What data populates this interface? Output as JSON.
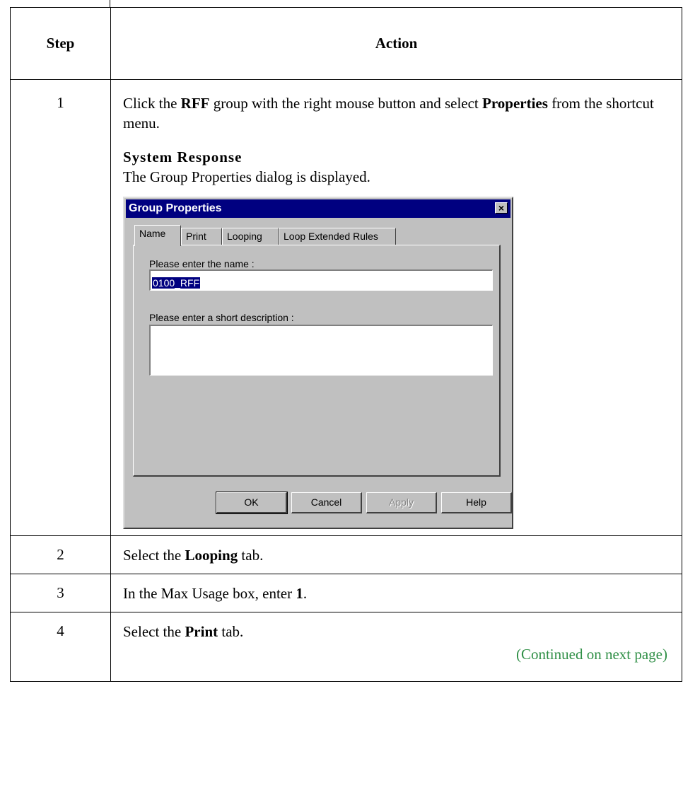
{
  "headers": {
    "step": "Step",
    "action": "Action"
  },
  "steps": [
    {
      "num": "1",
      "text_pre": "Click the ",
      "bold1": "RFF",
      "text_mid": " group with the right mouse button and select ",
      "bold2": "Properties",
      "text_post": " from the shortcut menu.",
      "response_title": "System Response",
      "response_text": "The Group Properties dialog is displayed."
    },
    {
      "num": "2",
      "text_pre": "Select the ",
      "bold": "Looping",
      "text_post": " tab."
    },
    {
      "num": "3",
      "text_pre": "In the Max Usage box, enter ",
      "bold": "1",
      "text_post": "."
    },
    {
      "num": "4",
      "text_pre": "Select the ",
      "bold": "Print",
      "text_post": " tab."
    }
  ],
  "continued": "(Continued on next page)",
  "dialog": {
    "title": "Group Properties",
    "close_glyph": "×",
    "tabs": [
      "Name",
      "Print",
      "Looping",
      "Loop Extended Rules"
    ],
    "name_label": "Please enter the name :",
    "name_value": "0100_RFF",
    "desc_label": "Please enter a short description :",
    "desc_value": "",
    "buttons": {
      "ok": "OK",
      "cancel": "Cancel",
      "apply": "Apply",
      "help": "Help"
    }
  }
}
